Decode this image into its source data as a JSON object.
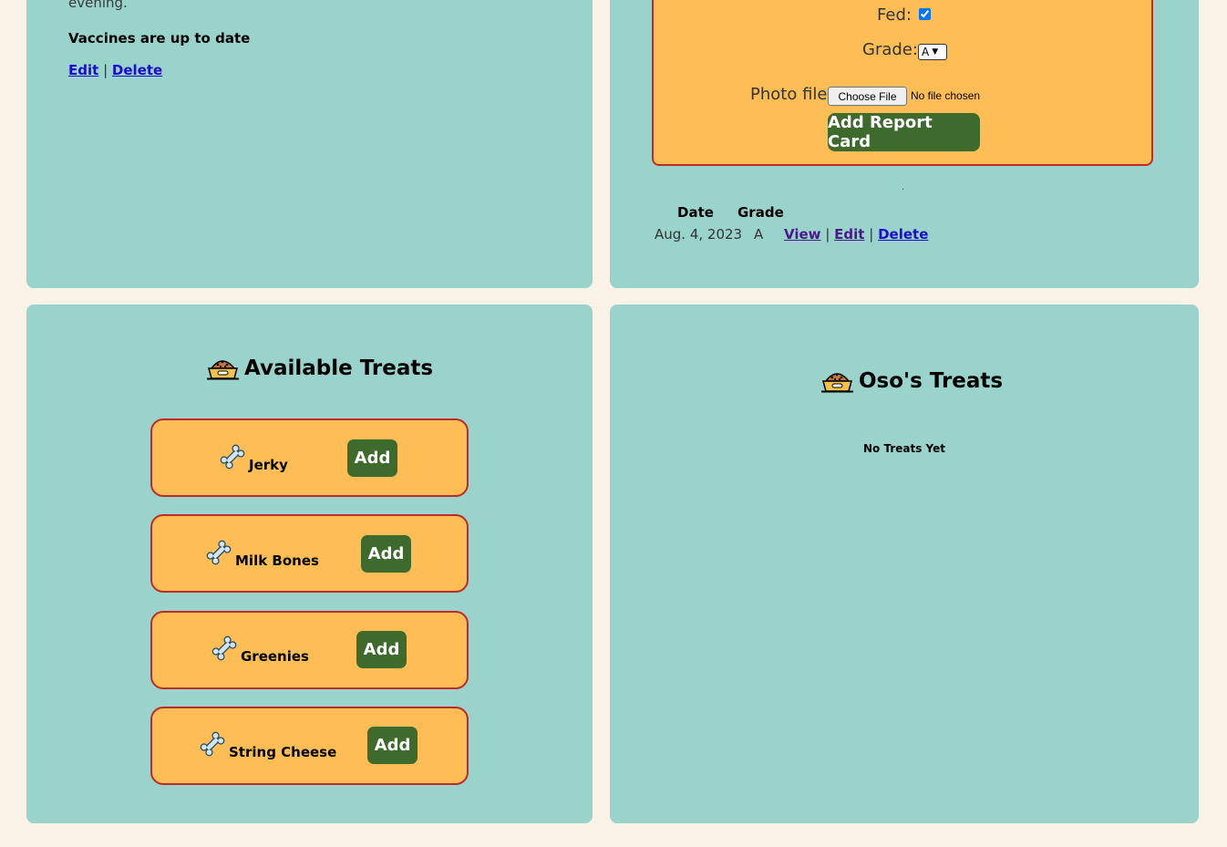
{
  "pet_info": {
    "evening_text": "evening.",
    "vaccines_text": "Vaccines are up to date",
    "edit_label": "Edit",
    "separator": "|",
    "delete_label": "Delete"
  },
  "report_form": {
    "fed_label": "Fed:",
    "fed_checked": true,
    "grade_label": "Grade:",
    "grade_value": "A",
    "photo_label": "Photo file:",
    "choose_file_label": "Choose File",
    "no_file_text": "No file chosen",
    "submit_label": "Add Report Card"
  },
  "report_table": {
    "dot": ".",
    "headers": [
      "Date",
      "Grade"
    ],
    "rows": [
      {
        "date": "Aug. 4, 2023",
        "grade": "A",
        "view": "View",
        "edit": "Edit",
        "delete": "Delete",
        "sep": "|"
      }
    ]
  },
  "available_treats": {
    "title": "Available Treats",
    "items": [
      {
        "name": "Jerky",
        "add_label": "Add"
      },
      {
        "name": "Milk Bones",
        "add_label": "Add"
      },
      {
        "name": "Greenies",
        "add_label": "Add"
      },
      {
        "name": "String Cheese",
        "add_label": "Add"
      }
    ]
  },
  "pet_treats": {
    "title": "Oso's Treats",
    "empty_text": "No Treats Yet"
  },
  "icons": {
    "heading_icon": "dog-food-bowl-icon",
    "treat_icon": "bone-icon"
  },
  "colors": {
    "page_bg": "#fbf3e8",
    "panel_bg": "#99d3cc",
    "card_bg": "#ffbe55",
    "card_border": "#c02a2a",
    "button_bg": "#3e6a2e",
    "link": "#1a0dcc"
  }
}
